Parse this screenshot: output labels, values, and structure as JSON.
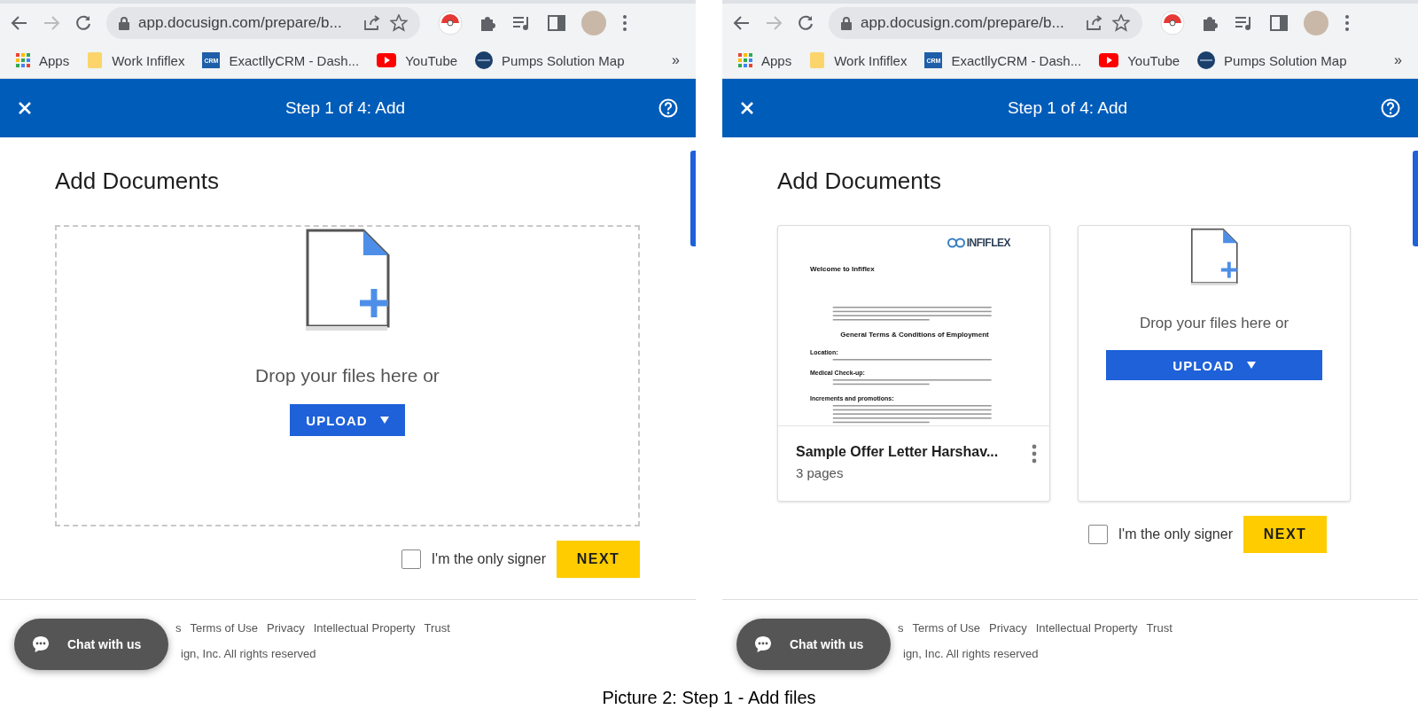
{
  "panels": [
    {
      "browser": {
        "url": "app.docusign.com/prepare/b...",
        "bookmarks": [
          {
            "label": "Apps",
            "kind": "apps"
          },
          {
            "label": "Work Infiflex",
            "kind": "folder"
          },
          {
            "label": "ExactllyCRM - Dash...",
            "kind": "crm",
            "badge": "CRM"
          },
          {
            "label": "YouTube",
            "kind": "youtube"
          },
          {
            "label": "Pumps Solution Map",
            "kind": "globe"
          }
        ],
        "more": "»"
      },
      "header": {
        "title": "Step 1 of 4: Add"
      },
      "heading": "Add Documents",
      "dropzone": {
        "kind": "large",
        "text": "Drop your files here or",
        "upload": "UPLOAD"
      },
      "only_signer": {
        "label": "I'm the only signer",
        "checked": false
      },
      "next": "NEXT",
      "chat": "Chat with us",
      "footer": {
        "fragment": "s",
        "links": [
          "Terms of Use",
          "Privacy",
          "Intellectual Property",
          "Trust"
        ],
        "copyright": "ign, Inc. All rights reserved"
      }
    },
    {
      "browser": {
        "url": "app.docusign.com/prepare/b...",
        "bookmarks": [
          {
            "label": "Apps",
            "kind": "apps"
          },
          {
            "label": "Work Infiflex",
            "kind": "folder"
          },
          {
            "label": "ExactllyCRM - Dash...",
            "kind": "crm",
            "badge": "CRM"
          },
          {
            "label": "YouTube",
            "kind": "youtube"
          },
          {
            "label": "Pumps Solution Map",
            "kind": "globe"
          }
        ],
        "more": "»"
      },
      "header": {
        "title": "Step 1 of 4: Add"
      },
      "heading": "Add Documents",
      "documents": [
        {
          "name": "Sample Offer Letter Harshav...",
          "pages": "3 pages",
          "preview": {
            "logo": "INFIFLEX",
            "title": "Welcome to Infiflex",
            "section": "General Terms & Conditions of Employment",
            "items": [
              "Location:",
              "Medical Check-up:",
              "Increments and promotions:"
            ]
          }
        }
      ],
      "dropzone": {
        "kind": "card",
        "text": "Drop your files here or",
        "upload": "UPLOAD"
      },
      "only_signer": {
        "label": "I'm the only signer",
        "checked": false
      },
      "next": "NEXT",
      "chat": "Chat with us",
      "footer": {
        "fragment": "s",
        "links": [
          "Terms of Use",
          "Privacy",
          "Intellectual Property",
          "Trust"
        ],
        "copyright": "ign, Inc. All rights reserved"
      }
    }
  ],
  "caption": "Picture 2: Step 1 - Add files"
}
